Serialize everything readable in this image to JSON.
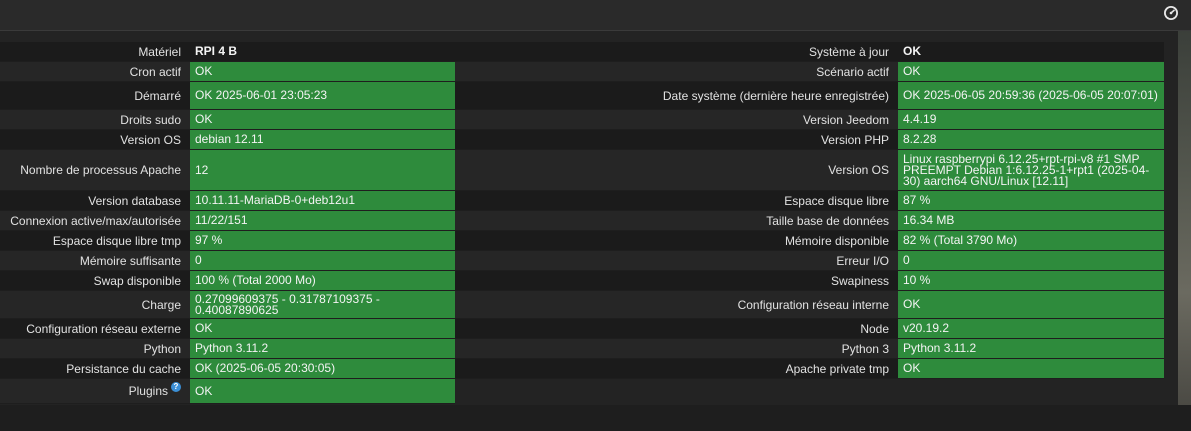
{
  "left_rows": [
    {
      "label": "Matériel",
      "value": "RPI 4 B",
      "ok": false,
      "h": 19
    },
    {
      "label": "Cron actif",
      "value": "OK",
      "ok": true,
      "h": 19
    },
    {
      "label": "Démarré",
      "value": "OK 2025-06-01 23:05:23",
      "ok": true,
      "h": 27
    },
    {
      "label": "Droits sudo",
      "value": "OK",
      "ok": true,
      "h": 19
    },
    {
      "label": "Version OS",
      "value": "debian 12.11",
      "ok": true,
      "h": 19
    },
    {
      "label": "Nombre de processus Apache",
      "value": "12",
      "ok": true,
      "h": 40
    },
    {
      "label": "Version database",
      "value": "10.11.11-MariaDB-0+deb12u1",
      "ok": true,
      "h": 19
    },
    {
      "label": "Connexion active/max/autorisée",
      "value": "11/22/151",
      "ok": true,
      "h": 19
    },
    {
      "label": "Espace disque libre tmp",
      "value": "97 %",
      "ok": true,
      "h": 19
    },
    {
      "label": "Mémoire suffisante",
      "value": "0",
      "ok": true,
      "h": 19
    },
    {
      "label": "Swap disponible",
      "value": "100 % (Total 2000 Mo)",
      "ok": true,
      "h": 19
    },
    {
      "label": "Charge",
      "value": "0.27099609375 - 0.31787109375 - 0.40087890625",
      "ok": true,
      "h": 27
    },
    {
      "label": "Configuration réseau externe",
      "value": "OK",
      "ok": true,
      "h": 19
    },
    {
      "label": "Python",
      "value": "Python 3.11.2",
      "ok": true,
      "h": 19
    },
    {
      "label": "Persistance du cache",
      "value": "OK (2025-06-05 20:30:05)",
      "ok": true,
      "h": 19
    },
    {
      "label": "Plugins",
      "value": "OK",
      "ok": true,
      "h": 24,
      "help": "?"
    }
  ],
  "right_rows": [
    {
      "label": "Système à jour",
      "value": "OK",
      "ok": false,
      "h": 19
    },
    {
      "label": "Scénario actif",
      "value": "OK",
      "ok": true,
      "h": 19
    },
    {
      "label": "Date système (dernière heure enregistrée)",
      "value": "OK 2025-06-05 20:59:36 (2025-06-05 20:07:01)",
      "ok": true,
      "h": 27
    },
    {
      "label": "Version Jeedom",
      "value": "4.4.19",
      "ok": true,
      "h": 19
    },
    {
      "label": "Version PHP",
      "value": "8.2.28",
      "ok": true,
      "h": 19
    },
    {
      "label": "Version OS",
      "value": "Linux raspberrypi 6.12.25+rpt-rpi-v8 #1 SMP PREEMPT Debian 1:6.12.25-1+rpt1 (2025-04-30) aarch64 GNU/Linux [12.11]",
      "ok": true,
      "h": 40
    },
    {
      "label": "Espace disque libre",
      "value": "87 %",
      "ok": true,
      "h": 19
    },
    {
      "label": "Taille base de données",
      "value": "16.34 MB",
      "ok": true,
      "h": 19
    },
    {
      "label": "Mémoire disponible",
      "value": "82 % (Total 3790 Mo)",
      "ok": true,
      "h": 19
    },
    {
      "label": "Erreur I/O",
      "value": "0",
      "ok": true,
      "h": 19
    },
    {
      "label": "Swapiness",
      "value": "10 %",
      "ok": true,
      "h": 19
    },
    {
      "label": "Configuration réseau interne",
      "value": "OK",
      "ok": true,
      "h": 27
    },
    {
      "label": "Node",
      "value": "v20.19.2",
      "ok": true,
      "h": 19
    },
    {
      "label": "Python 3",
      "value": "Python 3.11.2",
      "ok": true,
      "h": 19
    },
    {
      "label": "Apache private tmp",
      "value": "OK",
      "ok": true,
      "h": 19
    }
  ],
  "colors": {
    "ok": "#2e8b3c",
    "background": "#232323",
    "row_dark": "#1b1b1b",
    "row_light": "#262626"
  },
  "icons": {
    "top_right": "gauge-icon",
    "help": "help-icon"
  }
}
